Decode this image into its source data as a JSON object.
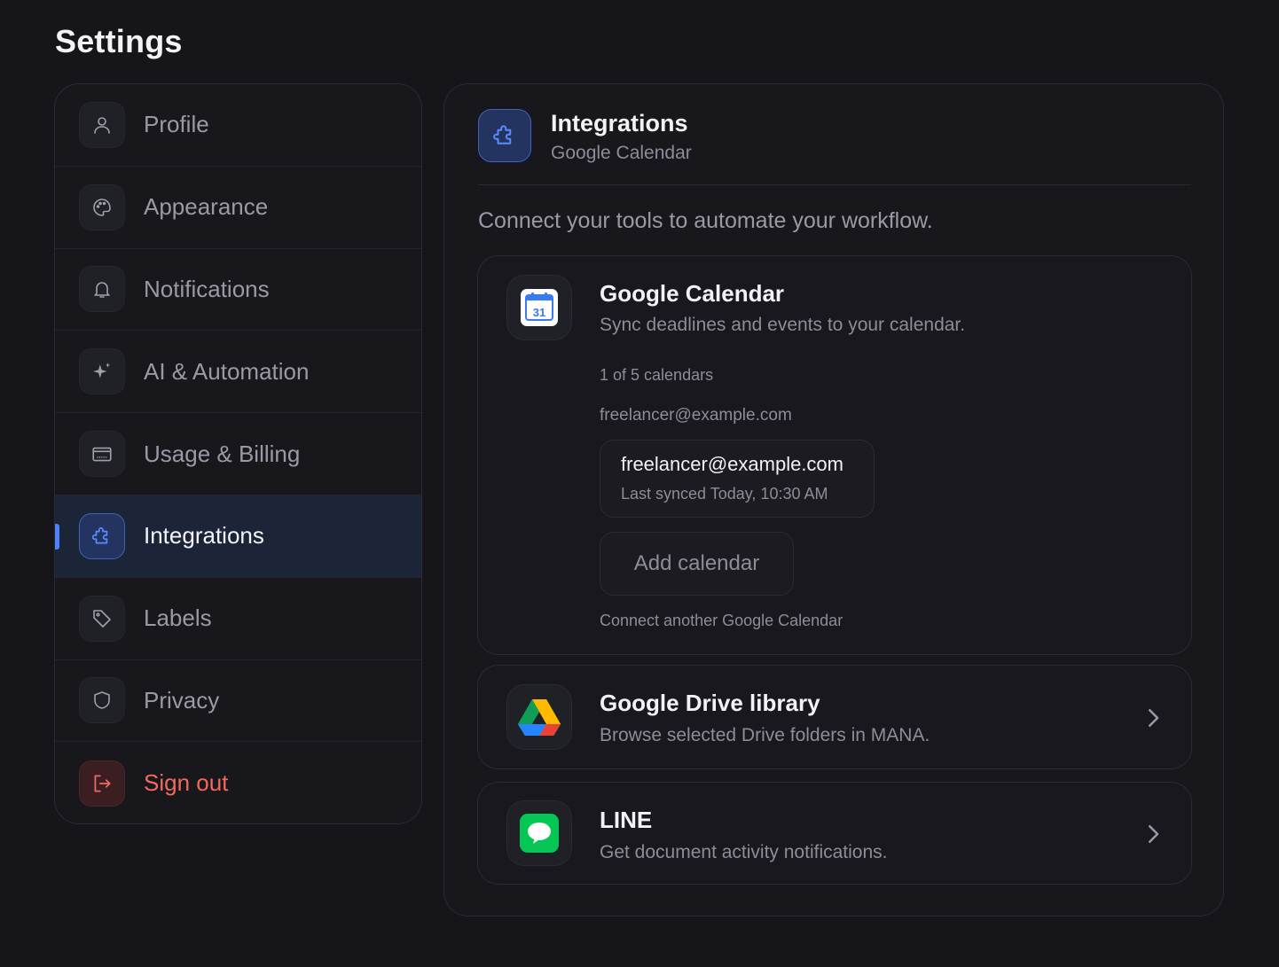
{
  "page": {
    "title": "Settings"
  },
  "sidebar": {
    "items": [
      {
        "label": "Profile",
        "icon": "user-icon"
      },
      {
        "label": "Appearance",
        "icon": "palette-icon"
      },
      {
        "label": "Notifications",
        "icon": "bell-icon"
      },
      {
        "label": "AI & Automation",
        "icon": "sparkle-icon"
      },
      {
        "label": "Usage & Billing",
        "icon": "credit-card-icon"
      },
      {
        "label": "Integrations",
        "icon": "puzzle-icon",
        "active": true
      },
      {
        "label": "Labels",
        "icon": "tag-icon"
      },
      {
        "label": "Privacy",
        "icon": "shield-icon"
      },
      {
        "label": "Sign out",
        "icon": "sign-out-icon",
        "danger": true
      }
    ]
  },
  "panel": {
    "title": "Integrations",
    "subtitle": "Google Calendar",
    "intro": "Connect your tools to automate your workflow.",
    "google_calendar": {
      "title": "Google Calendar",
      "description": "Sync deadlines and events to your calendar.",
      "count": "1 of 5 calendars",
      "account_label": "freelancer@example.com",
      "account": {
        "email": "freelancer@example.com",
        "sync": "Last synced Today, 10:30 AM"
      },
      "add_button": "Add calendar",
      "hint": "Connect another Google Calendar",
      "icon_day": "31"
    },
    "google_drive": {
      "title": "Google Drive library",
      "description": "Browse selected Drive folders in MANA."
    },
    "line": {
      "title": "LINE",
      "description": "Get document activity notifications."
    }
  },
  "colors": {
    "background": "#15151a",
    "accent": "#4d82ff",
    "danger": "#f26a5d",
    "line_green": "#06c755"
  }
}
